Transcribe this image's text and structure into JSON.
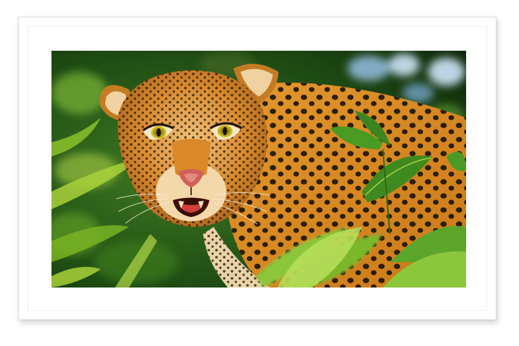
{
  "artwork": {
    "subject_icon": "leopard-icon",
    "mat_color": "#ffffff",
    "frame_color": "#f7f7f7",
    "palette": {
      "foliage_dark": "#123a10",
      "foliage_mid": "#2f6a1c",
      "foliage_light": "#8cc63a",
      "fur": "#d98a2a",
      "fur_light": "#f0c070",
      "spots": "#1a1208",
      "eyes": "#c8b020",
      "nose": "#d0605a",
      "bokeh_blue": "#9cc8f0"
    }
  }
}
